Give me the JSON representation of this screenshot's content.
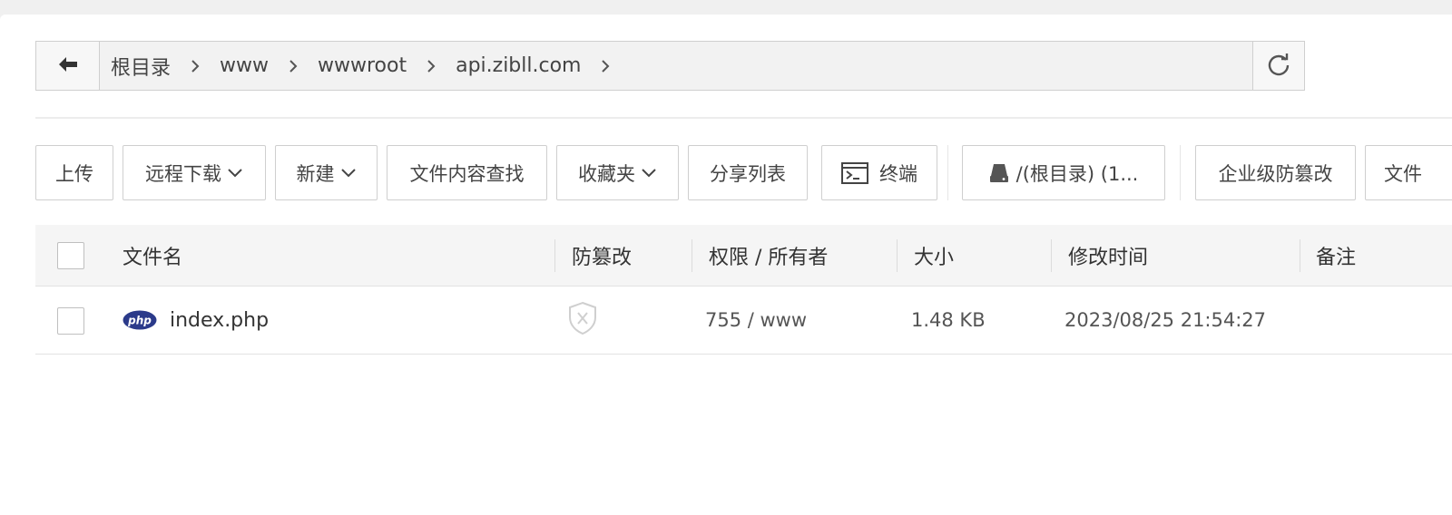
{
  "address_bar": {
    "crumbs": [
      "根目录",
      "www",
      "wwwroot",
      "api.zibll.com"
    ]
  },
  "toolbar": {
    "upload": "上传",
    "remote_download": "远程下载",
    "new": "新建",
    "content_search": "文件内容查找",
    "favorites": "收藏夹",
    "share_list": "分享列表",
    "terminal": "终端",
    "disk": "/(根目录) (1...",
    "enterprise_tamper": "企业级防篡改",
    "more": "文件"
  },
  "table": {
    "headers": {
      "name": "文件名",
      "tamper": "防篡改",
      "perm": "权限 / 所有者",
      "size": "大小",
      "mtime": "修改时间",
      "note": "备注"
    },
    "rows": [
      {
        "file_type_icon": "php-icon",
        "file_type_label": "php",
        "name": "index.php",
        "tamper_icon": "shield-x-icon",
        "perm": "755 / www",
        "size": "1.48 KB",
        "mtime": "2023/08/25 21:54:27",
        "note": ""
      }
    ]
  },
  "colors": {
    "php_badge": "#2b3a8a",
    "border": "#cfcfcf",
    "header_bg": "#f5f5f5"
  }
}
